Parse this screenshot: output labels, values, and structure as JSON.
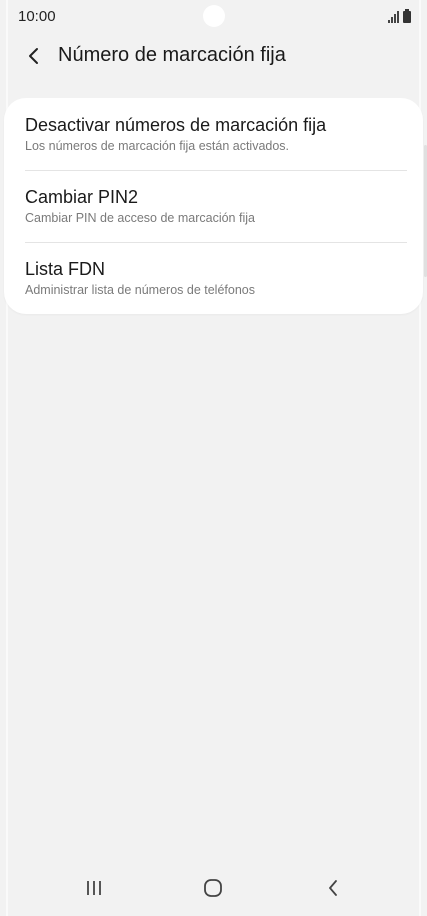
{
  "status_bar": {
    "time": "10:00",
    "icons": [
      "signal-icon",
      "battery-icon"
    ]
  },
  "header": {
    "back_icon": "chevron-left-icon",
    "title": "Número de marcación fija"
  },
  "settings": {
    "items": [
      {
        "title": "Desactivar números de marcación fija",
        "subtitle": "Los números de marcación fija están activados."
      },
      {
        "title": "Cambiar PIN2",
        "subtitle": "Cambiar PIN de acceso de marcación fija"
      },
      {
        "title": "Lista FDN",
        "subtitle": "Administrar lista de números de teléfonos"
      }
    ]
  },
  "nav_bar": {
    "buttons": [
      "recents-icon",
      "home-icon",
      "back-icon"
    ]
  },
  "colors": {
    "background": "#f2f2f2",
    "card": "#ffffff",
    "primary_text": "#1a1a1a",
    "secondary_text": "#7a7a7a"
  }
}
